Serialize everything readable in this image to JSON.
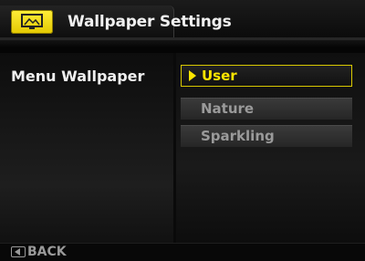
{
  "header": {
    "title": "Wallpaper Settings",
    "icon": "monitor-icon",
    "accent_color": "#ffe600"
  },
  "setting": {
    "label": "Menu Wallpaper"
  },
  "options": [
    {
      "label": "User",
      "selected": true
    },
    {
      "label": "Nature",
      "selected": false
    },
    {
      "label": "Sparkling",
      "selected": false
    }
  ],
  "footer": {
    "back_label": "BACK",
    "back_icon": "back-arrow-icon"
  }
}
